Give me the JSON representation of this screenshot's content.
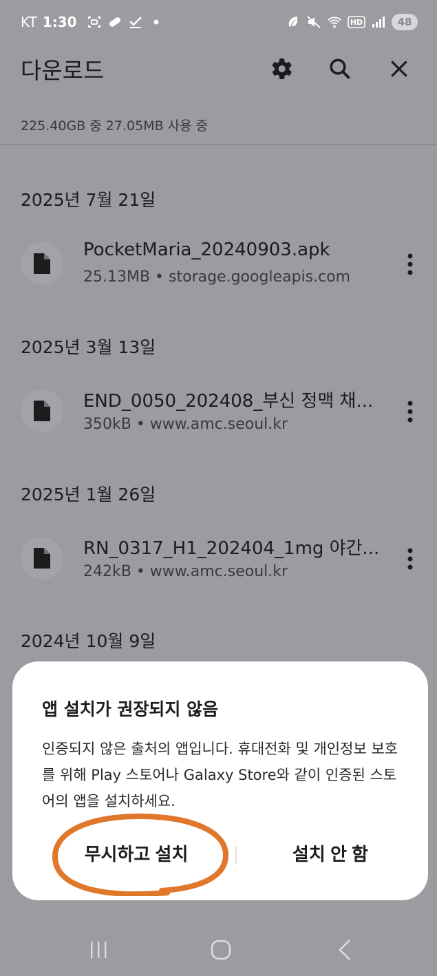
{
  "status_bar": {
    "carrier": "KT",
    "time": "1:30",
    "notification_icons": [
      "screenshot-icon",
      "pill-icon",
      "check-icon",
      "dot-icon"
    ],
    "system_icons": [
      "leaf-icon",
      "mute-icon",
      "wifi-icon",
      "hd-icon",
      "signal-icon"
    ],
    "hd_label": "HD",
    "battery": "48"
  },
  "app_bar": {
    "title": "다운로드",
    "actions": [
      "gear-icon",
      "search-icon",
      "close-icon"
    ]
  },
  "storage_text": "225.40GB 중 27.05MB 사용 중",
  "groups": [
    {
      "date": "2025년 7월 21일",
      "items": [
        {
          "name": "PocketMaria_20240903.apk",
          "meta": "25.13MB • storage.googleapis.com"
        }
      ]
    },
    {
      "date": "2025년 3월 13일",
      "items": [
        {
          "name": "END_0050_202408_부신 정맥 채...",
          "meta": "350kB • www.amc.seoul.kr"
        }
      ]
    },
    {
      "date": "2025년 1월 26일",
      "items": [
        {
          "name": "RN_0317_H1_202404_1mg 야간...",
          "meta": "242kB • www.amc.seoul.kr"
        }
      ]
    },
    {
      "date": "2024년 10월 9일",
      "items": []
    }
  ],
  "dialog": {
    "title": "앱 설치가 권장되지 않음",
    "body": "인증되지 않은 출처의 앱입니다. 휴대전화 및 개인정보 보호를 위해 Play 스토어나 Galaxy Store와 같이 인증된 스토어의 앱을 설치하세요.",
    "ignore_button": "무시하고 설치",
    "cancel_button": "설치 안 함"
  },
  "colors": {
    "scrim_background": "#9c9ba0",
    "dialog_background": "#ffffff",
    "annotation_circle": "#e0772b"
  },
  "nav_bar": [
    "recents-icon",
    "home-icon",
    "back-icon"
  ]
}
